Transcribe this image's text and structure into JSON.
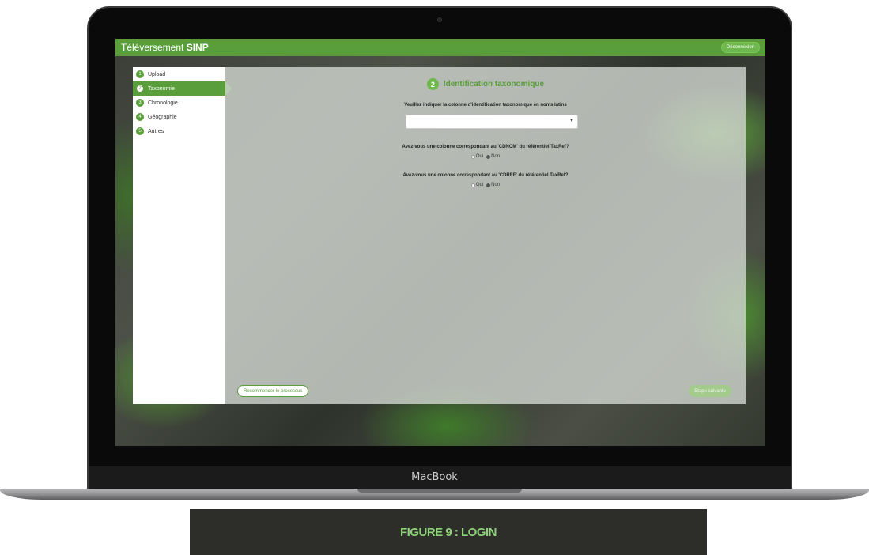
{
  "device": {
    "label": "MacBook"
  },
  "app": {
    "title_regular": "Téléversement ",
    "title_bold": "SINP",
    "logout_label": "Déconnexion"
  },
  "sidebar": {
    "steps": [
      {
        "num": "1",
        "label": "Upload",
        "active": false
      },
      {
        "num": "2",
        "label": "Taxonomie",
        "active": true
      },
      {
        "num": "3",
        "label": "Chronologie",
        "active": false
      },
      {
        "num": "4",
        "label": "Géographie",
        "active": false
      },
      {
        "num": "5",
        "label": "Autres",
        "active": false
      }
    ]
  },
  "main": {
    "section_num": "2",
    "section_title": "Identification taxonomique",
    "q1": "Veuillez indiquer la colonne d'identification taxonomique en noms latins",
    "select_value": "",
    "q2": "Avez-vous une colonne correspondant au 'CDNOM' du référentiel TaxRef?",
    "q2_yes": "Oui",
    "q2_no": "Non",
    "q2_selected": "Non",
    "q3": "Avez-vous une colonne correspondant au 'CDREF' du référentiel TaxRef?",
    "q3_yes": "Oui",
    "q3_no": "Non",
    "q3_selected": "Non",
    "restart_label": "Recommencer le processus",
    "next_label": "Etape suivante"
  },
  "caption": "FIGURE 9 : LOGIN"
}
